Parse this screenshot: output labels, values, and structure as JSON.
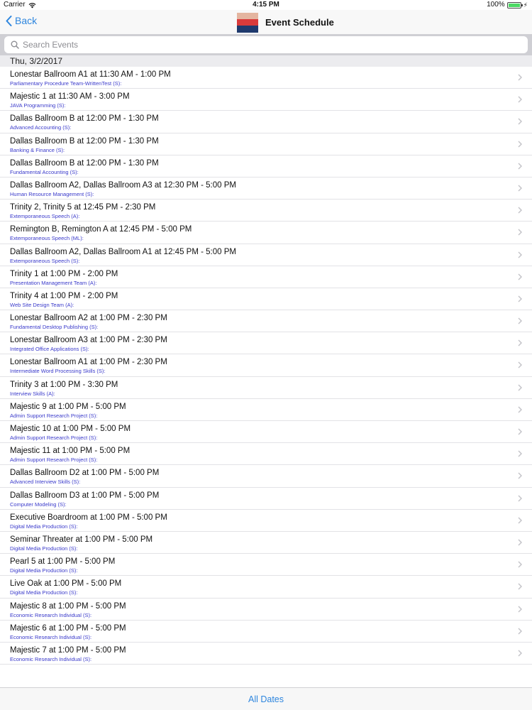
{
  "status": {
    "carrier": "Carrier",
    "time": "4:15 PM",
    "battery_text": "100%",
    "battery_level": 1.0
  },
  "nav": {
    "back_label": "Back",
    "title": "Event Schedule"
  },
  "search": {
    "placeholder": "Search Events",
    "value": ""
  },
  "section": {
    "date": "Thu, 3/2/2017"
  },
  "events": [
    {
      "title": "Lonestar Ballroom A1 at 11:30 AM - 1:00 PM",
      "subtitle": "Parliamentary Procedure Team-WrittenTest (S):"
    },
    {
      "title": "Majestic 1 at 11:30 AM - 3:00 PM",
      "subtitle": "JAVA Programming (S):"
    },
    {
      "title": "Dallas Ballroom B at 12:00 PM - 1:30 PM",
      "subtitle": "Advanced Accounting (S):"
    },
    {
      "title": "Dallas Ballroom B at 12:00 PM - 1:30 PM",
      "subtitle": "Banking & Finance (S):"
    },
    {
      "title": "Dallas Ballroom B at 12:00 PM - 1:30 PM",
      "subtitle": "Fundamental Accounting (S):"
    },
    {
      "title": "Dallas Ballroom A2, Dallas Ballroom A3 at 12:30 PM - 5:00 PM",
      "subtitle": "Human Resource Management (S):"
    },
    {
      "title": "Trinity 2, Trinity 5 at 12:45 PM - 2:30 PM",
      "subtitle": "Extemporaneous Speech (A):"
    },
    {
      "title": "Remington B, Remington A at 12:45 PM - 5:00 PM",
      "subtitle": "Extemporaneous Speech (ML):"
    },
    {
      "title": "Dallas Ballroom A2, Dallas Ballroom A1 at 12:45 PM - 5:00 PM",
      "subtitle": "Extemporaneous Speech (S):"
    },
    {
      "title": "Trinity 1 at 1:00 PM - 2:00 PM",
      "subtitle": "Presentation Management Team (A):"
    },
    {
      "title": "Trinity 4 at 1:00 PM - 2:00 PM",
      "subtitle": "Web Site Design Team (A):"
    },
    {
      "title": "Lonestar Ballroom A2 at 1:00 PM - 2:30 PM",
      "subtitle": "Fundamental Desktop Publishing (S):"
    },
    {
      "title": "Lonestar Ballroom A3 at 1:00 PM - 2:30 PM",
      "subtitle": "Integrated Office Applications (S):"
    },
    {
      "title": "Lonestar Ballroom A1 at 1:00 PM - 2:30 PM",
      "subtitle": "Intermediate Word Processing Skills (S):"
    },
    {
      "title": "Trinity 3 at 1:00 PM - 3:30 PM",
      "subtitle": "Interview Skills (A):"
    },
    {
      "title": "Majestic 9 at 1:00 PM - 5:00 PM",
      "subtitle": "Admin Support Research Project (S):"
    },
    {
      "title": "Majestic 10 at 1:00 PM - 5:00 PM",
      "subtitle": "Admin Support Research Project (S):"
    },
    {
      "title": "Majestic 11 at 1:00 PM - 5:00 PM",
      "subtitle": "Admin Support Research Project (S):"
    },
    {
      "title": "Dallas Ballroom D2 at 1:00 PM - 5:00 PM",
      "subtitle": "Advanced Interview Skills (S):"
    },
    {
      "title": "Dallas Ballroom D3 at 1:00 PM - 5:00 PM",
      "subtitle": "Computer Modeling (S):"
    },
    {
      "title": "Executive Boardroom at 1:00 PM - 5:00 PM",
      "subtitle": "Digital Media Production (S):"
    },
    {
      "title": "Seminar Threater at 1:00 PM - 5:00 PM",
      "subtitle": "Digital Media Production (S):"
    },
    {
      "title": "Pearl 5 at 1:00 PM - 5:00 PM",
      "subtitle": "Digital Media Production (S):"
    },
    {
      "title": "Live Oak at 1:00 PM - 5:00 PM",
      "subtitle": "Digital Media Production (S):"
    },
    {
      "title": "Majestic 8 at 1:00 PM - 5:00 PM",
      "subtitle": "Economic Research Individual (S):"
    },
    {
      "title": "Majestic 6 at 1:00 PM - 5:00 PM",
      "subtitle": "Economic Research Individual (S):"
    },
    {
      "title": "Majestic 7 at 1:00 PM - 5:00 PM",
      "subtitle": "Economic Research Individual (S):"
    }
  ],
  "bottom": {
    "all_dates_label": "All Dates"
  },
  "colors": {
    "accent": "#2e86de",
    "subtitle": "#3a3acb",
    "battery": "#4cd964"
  },
  "icons": {
    "back": "chevron-left-icon",
    "search": "magnifier-icon",
    "row": "chevron-right-icon",
    "wifi": "wifi-icon",
    "battery": "battery-icon",
    "charge": "bolt-icon"
  }
}
